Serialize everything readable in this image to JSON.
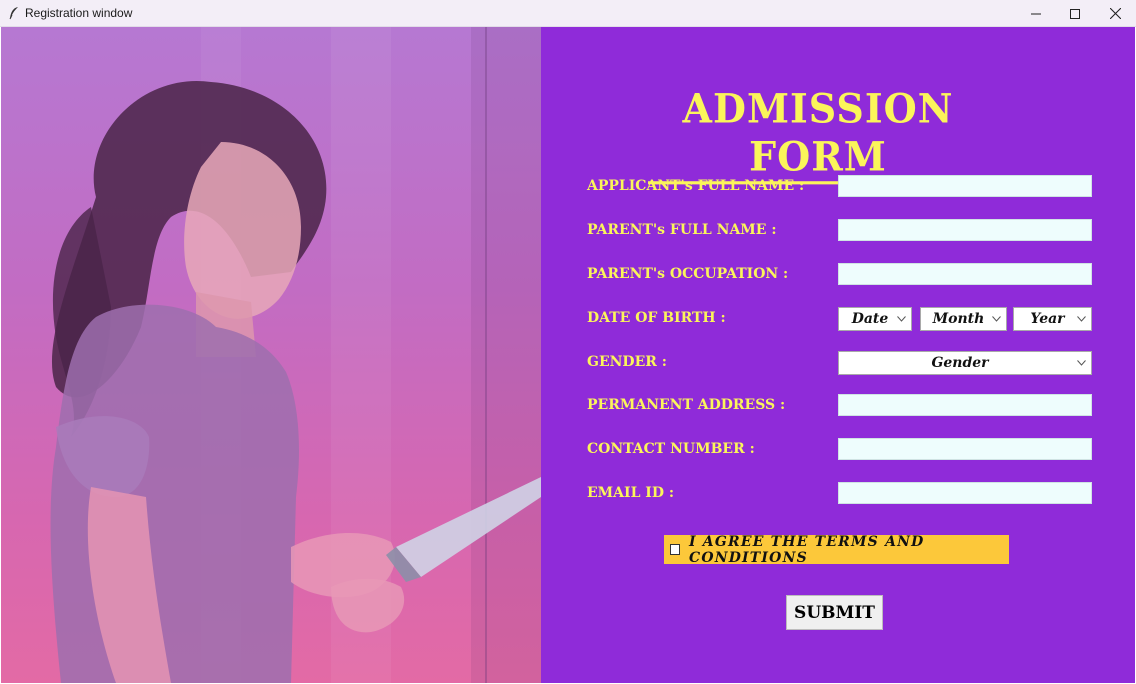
{
  "window": {
    "title": "Registration window",
    "icon": "feather-icon",
    "controls": [
      "minimize-icon",
      "maximize-icon",
      "close-icon"
    ]
  },
  "colors": {
    "form_background": "#8f2bd9",
    "label_color": "#fbf55a",
    "input_background": "#eefdfd",
    "terms_background": "#fcc83a",
    "photo_tint": "#d767b0"
  },
  "photo": {
    "description_icon": "woman-with-tablet-image"
  },
  "form": {
    "title": "ADMISSION FORM",
    "fields": {
      "applicant_name": {
        "label": "APPLICANT's FULL NAME :",
        "value": ""
      },
      "parent_name": {
        "label": "PARENT's FULL NAME :",
        "value": ""
      },
      "parent_occupation": {
        "label": "PARENT's OCCUPATION :",
        "value": ""
      },
      "dob": {
        "label": "DATE OF BIRTH :",
        "date": "Date",
        "month": "Month",
        "year": "Year"
      },
      "gender": {
        "label": "GENDER :",
        "value": "Gender"
      },
      "address": {
        "label": "PERMANENT ADDRESS :",
        "value": ""
      },
      "contact": {
        "label": "CONTACT NUMBER :",
        "value": ""
      },
      "email": {
        "label": "EMAIL ID :",
        "value": ""
      }
    },
    "terms": {
      "label": "I agree the terms and conditions",
      "checked": false
    },
    "submit_label": "SUBMIT"
  }
}
